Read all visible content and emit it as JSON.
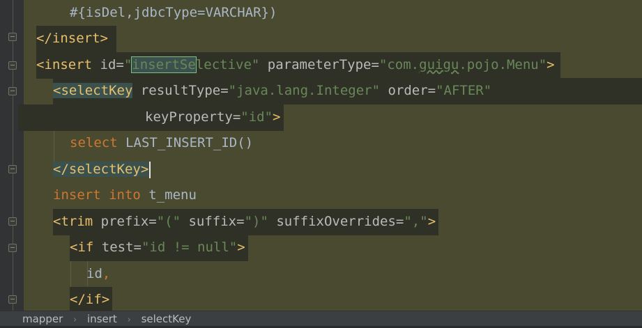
{
  "editor": {
    "lines": [
      {
        "tokens": [
          {
            "t": "#{isDel,jdbcType=VARCHAR})",
            "c": "t-plain"
          }
        ]
      },
      {
        "tokens": [
          {
            "t": "</insert>",
            "c": "t-tag"
          }
        ]
      },
      {
        "tokens": [
          {
            "t": "<insert",
            "c": "t-tag"
          },
          {
            "t": " id=",
            "c": "t-attr"
          },
          {
            "t": "\"",
            "c": "t-str"
          },
          {
            "t": "insertSe",
            "c": "t-str boxed"
          },
          {
            "t": "lective\"",
            "c": "t-str"
          },
          {
            "t": " parameterType=",
            "c": "t-attr"
          },
          {
            "t": "\"com.",
            "c": "t-str"
          },
          {
            "t": "guigu",
            "c": "t-str squiggle"
          },
          {
            "t": ".pojo.Menu\"",
            "c": "t-str"
          },
          {
            "t": ">",
            "c": "t-tag"
          }
        ]
      },
      {
        "tokens": [
          {
            "t": "<selectKey",
            "c": "t-tag matched"
          },
          {
            "t": " resultType=",
            "c": "t-attr"
          },
          {
            "t": "\"java.lang.Integer\"",
            "c": "t-str"
          },
          {
            "t": " order=",
            "c": "t-attr"
          },
          {
            "t": "\"AFTER\"",
            "c": "t-str"
          }
        ]
      },
      {
        "tokens": [
          {
            "t": "keyProperty=",
            "c": "t-attr"
          },
          {
            "t": "\"id\"",
            "c": "t-str"
          },
          {
            "t": ">",
            "c": "t-tag"
          }
        ]
      },
      {
        "tokens": [
          {
            "t": "select",
            "c": "t-kw"
          },
          {
            "t": " LAST_INSERT_ID()",
            "c": "t-plain"
          }
        ]
      },
      {
        "tokens": [
          {
            "t": "</selectKey>",
            "c": "t-tag matched"
          }
        ]
      },
      {
        "tokens": [
          {
            "t": "insert",
            "c": "t-kw"
          },
          {
            "t": " ",
            "c": "t-plain"
          },
          {
            "t": "into",
            "c": "t-kw"
          },
          {
            "t": " t_menu",
            "c": "t-plain"
          }
        ]
      },
      {
        "tokens": [
          {
            "t": "<trim",
            "c": "t-tag"
          },
          {
            "t": " prefix=",
            "c": "t-attr"
          },
          {
            "t": "\"(\"",
            "c": "t-str"
          },
          {
            "t": " suffix=",
            "c": "t-attr"
          },
          {
            "t": "\")\"",
            "c": "t-str"
          },
          {
            "t": " suffixOverrides=",
            "c": "t-attr"
          },
          {
            "t": "\",\"",
            "c": "t-str"
          },
          {
            "t": ">",
            "c": "t-tag"
          }
        ]
      },
      {
        "tokens": [
          {
            "t": "<if",
            "c": "t-tag"
          },
          {
            "t": " test=",
            "c": "t-attr"
          },
          {
            "t": "\"id != null\"",
            "c": "t-str"
          },
          {
            "t": ">",
            "c": "t-tag"
          }
        ]
      },
      {
        "tokens": [
          {
            "t": "id",
            "c": "t-plain"
          },
          {
            "t": ",",
            "c": "t-kw"
          }
        ]
      },
      {
        "tokens": [
          {
            "t": "</if>",
            "c": "t-tag"
          }
        ]
      }
    ]
  },
  "breadcrumb": {
    "items": [
      "mapper",
      "insert",
      "selectKey"
    ]
  },
  "colors": {
    "editor_bg": "#4a4a30",
    "tag": "#e8bf6a",
    "string": "#6a8759",
    "keyword": "#cc7832",
    "attribute": "#bababa"
  }
}
